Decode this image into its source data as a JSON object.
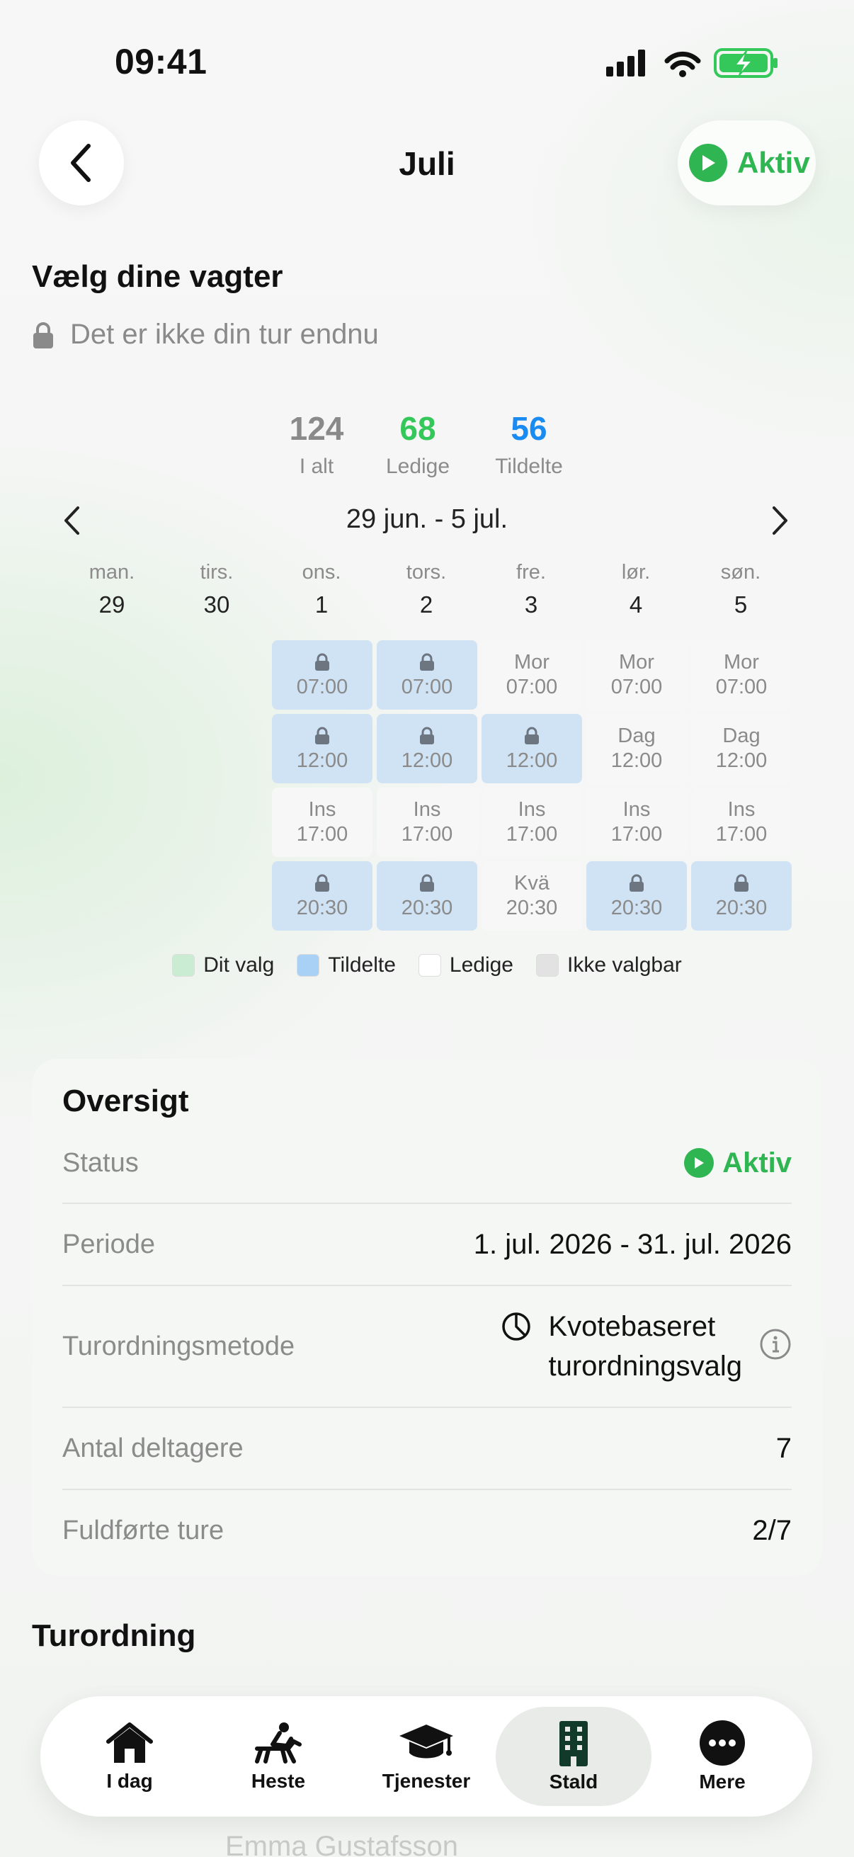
{
  "status_bar": {
    "time": "09:41"
  },
  "header": {
    "title": "Juli",
    "status_pill": "Aktiv"
  },
  "section_title": "Vælg dine vagter",
  "lock_note": "Det er ikke din tur endnu",
  "stats": [
    {
      "value": "124",
      "label": "I alt",
      "color": "#8a8a8a"
    },
    {
      "value": "68",
      "label": "Ledige",
      "color": "#34c759"
    },
    {
      "value": "56",
      "label": "Tildelte",
      "color": "#1a8bf0"
    }
  ],
  "week_range": "29 jun. - 5 jul.",
  "days": [
    {
      "name": "man.",
      "num": "29"
    },
    {
      "name": "tirs.",
      "num": "30"
    },
    {
      "name": "ons.",
      "num": "1"
    },
    {
      "name": "tors.",
      "num": "2"
    },
    {
      "name": "fre.",
      "num": "3"
    },
    {
      "name": "lør.",
      "num": "4"
    },
    {
      "name": "søn.",
      "num": "5"
    }
  ],
  "shifts": {
    "ons": [
      {
        "state": "assigned",
        "time": "07:00"
      },
      {
        "state": "assigned",
        "time": "12:00"
      },
      {
        "state": "free",
        "label": "Ins",
        "time": "17:00"
      },
      {
        "state": "assigned",
        "time": "20:30"
      }
    ],
    "tors": [
      {
        "state": "assigned",
        "time": "07:00"
      },
      {
        "state": "assigned",
        "time": "12:00"
      },
      {
        "state": "free",
        "label": "Ins",
        "time": "17:00"
      },
      {
        "state": "assigned",
        "time": "20:30"
      }
    ],
    "fre": [
      {
        "state": "free",
        "label": "Mor",
        "time": "07:00"
      },
      {
        "state": "assigned",
        "time": "12:00"
      },
      {
        "state": "free",
        "label": "Ins",
        "time": "17:00"
      },
      {
        "state": "free",
        "label": "Kvä",
        "time": "20:30"
      }
    ],
    "lor": [
      {
        "state": "free",
        "label": "Mor",
        "time": "07:00"
      },
      {
        "state": "free",
        "label": "Dag",
        "time": "12:00"
      },
      {
        "state": "free",
        "label": "Ins",
        "time": "17:00"
      },
      {
        "state": "assigned",
        "time": "20:30"
      }
    ],
    "son": [
      {
        "state": "free",
        "label": "Mor",
        "time": "07:00"
      },
      {
        "state": "free",
        "label": "Dag",
        "time": "12:00"
      },
      {
        "state": "free",
        "label": "Ins",
        "time": "17:00"
      },
      {
        "state": "assigned",
        "time": "20:30"
      }
    ]
  },
  "legend": [
    {
      "label": "Dit valg",
      "color": "#c9ecd2"
    },
    {
      "label": "Tildelte",
      "color": "#a9d1f5"
    },
    {
      "label": "Ledige",
      "color": "#ffffff"
    },
    {
      "label": "Ikke valgbar",
      "color": "#e2e2e2"
    }
  ],
  "overview": {
    "title": "Oversigt",
    "status_label": "Status",
    "status_value": "Aktiv",
    "period_label": "Periode",
    "period_value": "1. jul. 2026 - 31. jul. 2026",
    "method_label": "Turordningsmetode",
    "method_value_line1": "Kvotebaseret",
    "method_value_line2": "turordningsvalg",
    "participants_label": "Antal deltagere",
    "participants_value": "7",
    "completed_label": "Fuldførte ture",
    "completed_value": "2/7"
  },
  "turordning_title": "Turordning",
  "ghost_name": "Emma Gustafsson",
  "tabs": [
    {
      "label": "I dag",
      "icon": "house-icon"
    },
    {
      "label": "Heste",
      "icon": "horse-rider-icon"
    },
    {
      "label": "Tjenester",
      "icon": "graduation-cap-icon"
    },
    {
      "label": "Stald",
      "icon": "building-icon"
    },
    {
      "label": "Mere",
      "icon": "more-icon"
    }
  ]
}
